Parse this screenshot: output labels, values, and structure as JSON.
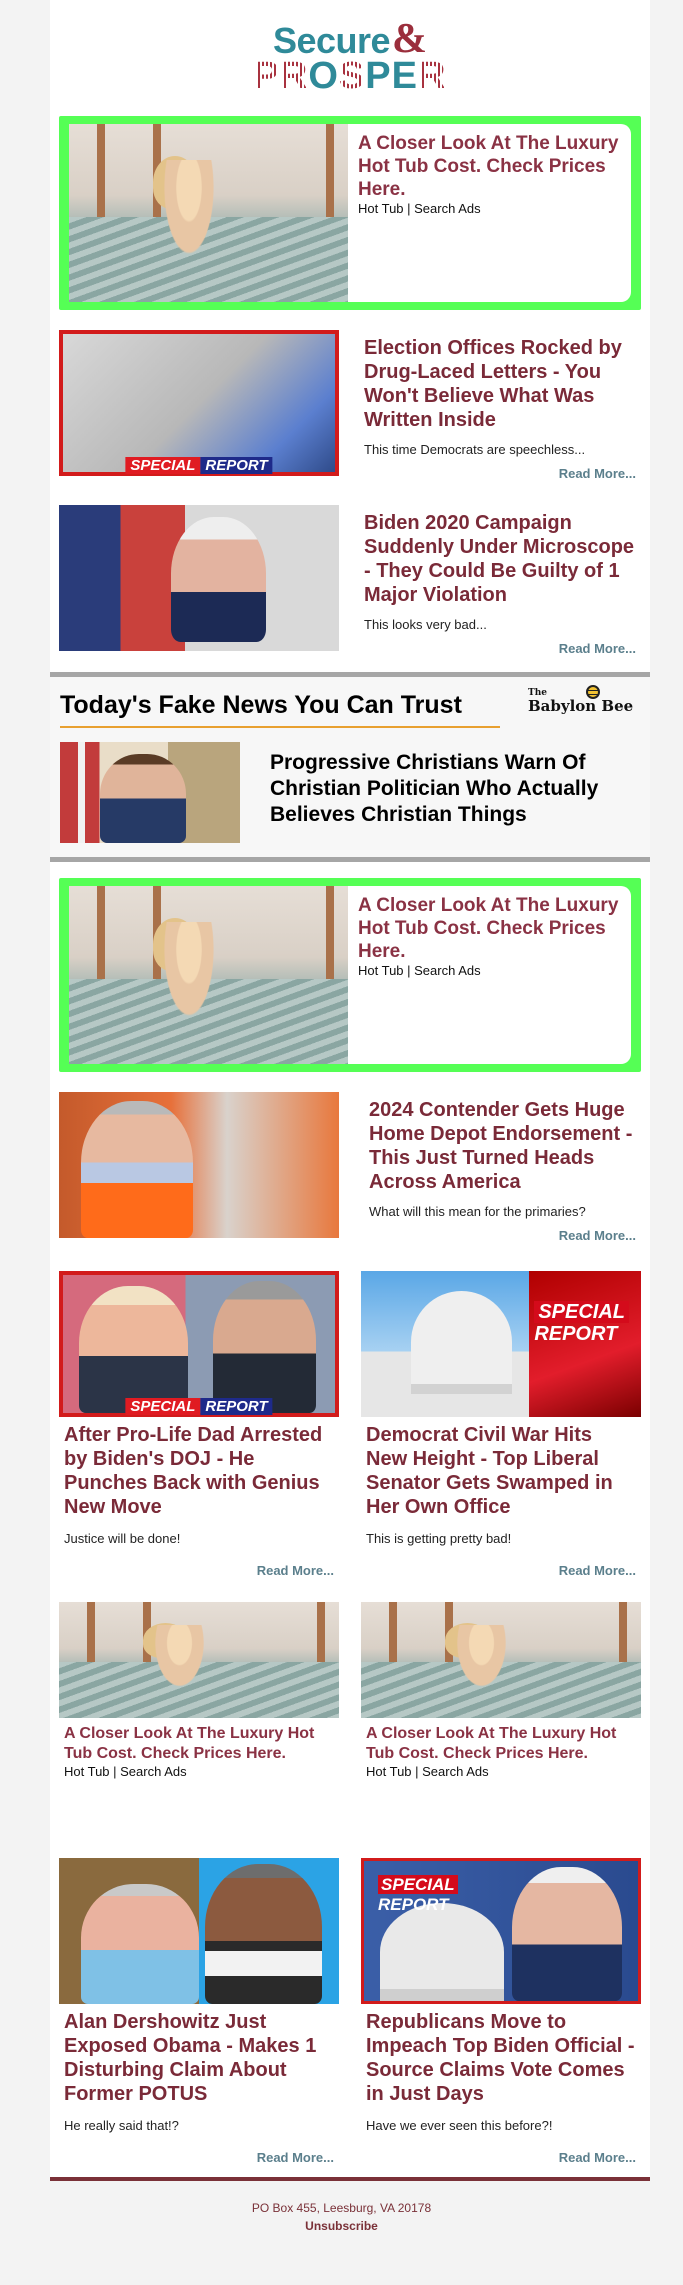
{
  "brand": {
    "logo_top": "Secure",
    "logo_amp": "&",
    "logo_bottom": [
      "P",
      "R",
      "O",
      "S",
      "P",
      "E",
      "R"
    ],
    "colors": {
      "teal": "#2f8a99",
      "maroon": "#9b2e3c",
      "ad_green": "#55ff55",
      "title": "#7a2a38",
      "read_more": "#5b7f8c",
      "accent_orange": "#e8a030"
    }
  },
  "ads": {
    "hot_tub": {
      "title": "A Closer Look At The Luxury Hot Tub Cost. Check Prices Here.",
      "subtitle": "Hot Tub | Search Ads"
    }
  },
  "articles_top": [
    {
      "title": "Election Offices Rocked by Drug-Laced Letters - You Won't Believe What Was Written Inside",
      "teaser": "This time Democrats are speechless...",
      "read_more": "Read More...",
      "badge": {
        "special": "SPECIAL",
        "report": "REPORT"
      }
    },
    {
      "title": "Biden 2020 Campaign Suddenly Under Microscope - They Could Be Guilty of 1 Major Violation",
      "teaser": "This looks very bad...",
      "read_more": "Read More..."
    }
  ],
  "babylon": {
    "heading": "Today's Fake News You Can Trust",
    "logo_the": "The",
    "logo_name": "Babylon Bee",
    "article_title": "Progressive Christians Warn Of Christian Politician Who Actually Believes Christian Things"
  },
  "article_homedepot": {
    "title": "2024 Contender Gets Huge Home Depot Endorsement - This Just Turned Heads Across America",
    "teaser": "What will this mean for the primaries?",
    "read_more": "Read More..."
  },
  "grid_row1": [
    {
      "title": "After Pro-Life Dad Arrested by Biden's DOJ - He Punches Back with Genius New Move",
      "teaser": "Justice will be done!",
      "read_more": "Read More...",
      "badge": {
        "special": "SPECIAL",
        "report": "REPORT"
      }
    },
    {
      "title": "Democrat Civil War Hits New Height - Top Liberal Senator Gets Swamped in Her Own Office",
      "teaser": "This is getting pretty bad!",
      "read_more": "Read More...",
      "badge": {
        "special": "SPECIAL",
        "report": "REPORT"
      }
    }
  ],
  "grid_row3": [
    {
      "title": "Alan Dershowitz Just Exposed Obama - Makes 1 Disturbing Claim About Former POTUS",
      "teaser": "He really said that!?",
      "read_more": "Read More..."
    },
    {
      "title": "Republicans Move to Impeach Top Biden Official - Source Claims Vote Comes in Just Days",
      "teaser": "Have we ever seen this before?!",
      "read_more": "Read More...",
      "badge": {
        "special": "SPECIAL",
        "report": "REPORT"
      }
    }
  ],
  "footer": {
    "address": "PO Box 455, Leesburg, VA 20178",
    "unsubscribe": "Unsubscribe"
  }
}
